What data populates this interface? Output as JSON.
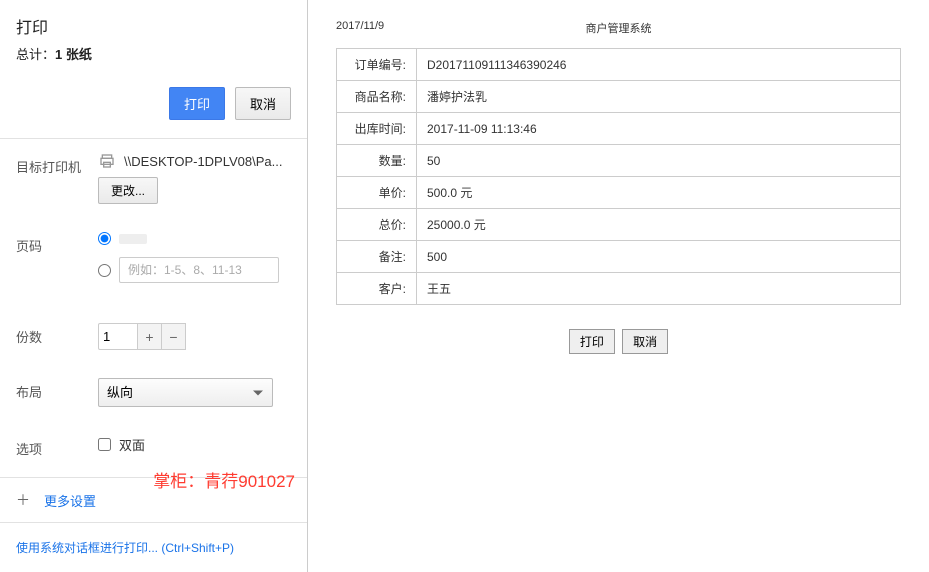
{
  "panel": {
    "title": "打印",
    "summary_prefix": "总计：",
    "summary_value": "1 张纸",
    "print_btn": "打印",
    "cancel_btn": "取消"
  },
  "destination": {
    "label": "目标打印机",
    "printer": "\\\\DESKTOP-1DPLV08\\Pa...",
    "change_btn": "更改..."
  },
  "pages": {
    "label": "页码",
    "placeholder": "例如：1-5、8、11-13"
  },
  "copies": {
    "label": "份数",
    "value": "1"
  },
  "layout": {
    "label": "布局",
    "value": "纵向"
  },
  "options": {
    "label": "选项",
    "duplex": "双面"
  },
  "more": "更多设置",
  "system_link": "使用系统对话框进行打印... (Ctrl+Shift+P)",
  "watermark": "掌柜：青荇901027",
  "preview": {
    "date": "2017/11/9",
    "system_name": "商户管理系统",
    "rows": [
      {
        "label": "订单编号:",
        "value": "D20171109111346390246"
      },
      {
        "label": "商品名称:",
        "value": "潘婷护法乳"
      },
      {
        "label": "出库时间:",
        "value": "2017-11-09 11:13:46"
      },
      {
        "label": "数量:",
        "value": "50"
      },
      {
        "label": "单价:",
        "value": "500.0 元"
      },
      {
        "label": "总价:",
        "value": "25000.0 元"
      },
      {
        "label": "备注:",
        "value": "500"
      },
      {
        "label": "客户:",
        "value": "王五"
      }
    ],
    "print_btn": "打印",
    "cancel_btn": "取消"
  }
}
